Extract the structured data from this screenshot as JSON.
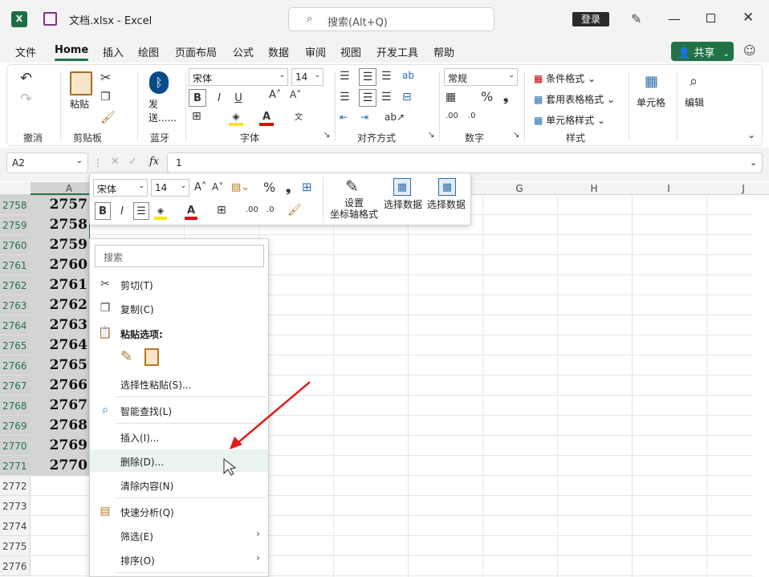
{
  "app": {
    "title": "文档.xlsx  -  Excel",
    "search_placeholder": "搜索(Alt+Q)",
    "login": "登录",
    "share": "共享",
    "accent": "#217346"
  },
  "tabs": [
    "文件",
    "Home",
    "插入",
    "绘图",
    "页面布局",
    "公式",
    "数据",
    "审阅",
    "视图",
    "开发工具",
    "帮助"
  ],
  "ribbon": {
    "groups": {
      "undo": "撤消",
      "clipboard": "剪贴板",
      "bluetooth": "蓝牙",
      "font": "字体",
      "align": "对齐方式",
      "number": "数字",
      "styles": "样式"
    },
    "paste": "粘贴",
    "send": "发送......",
    "font_name": "宋体",
    "font_size": "14",
    "number_format": "常规",
    "cond_format": "条件格式",
    "table_format": "套用表格格式",
    "cell_style": "单元格样式",
    "cells": "单元格",
    "editing": "编辑"
  },
  "formula": {
    "namebox": "A2",
    "fx": "fx",
    "value": "1"
  },
  "columns": [
    "A",
    "G",
    "H",
    "I",
    "J"
  ],
  "rows": [
    {
      "num": "2758",
      "val": "2757",
      "sel": true
    },
    {
      "num": "2759",
      "val": "2758",
      "sel": true
    },
    {
      "num": "2760",
      "val": "2759",
      "sel": true
    },
    {
      "num": "2761",
      "val": "2760",
      "sel": true
    },
    {
      "num": "2762",
      "val": "2761",
      "sel": true
    },
    {
      "num": "2763",
      "val": "2762",
      "sel": true
    },
    {
      "num": "2764",
      "val": "2763",
      "sel": true
    },
    {
      "num": "2765",
      "val": "2764",
      "sel": true
    },
    {
      "num": "2766",
      "val": "2765",
      "sel": true
    },
    {
      "num": "2767",
      "val": "2766",
      "sel": true
    },
    {
      "num": "2768",
      "val": "2767",
      "sel": true
    },
    {
      "num": "2769",
      "val": "2768",
      "sel": true
    },
    {
      "num": "2770",
      "val": "2769",
      "sel": true
    },
    {
      "num": "2771",
      "val": "2770",
      "sel": true
    },
    {
      "num": "2772",
      "val": "",
      "sel": false
    },
    {
      "num": "2773",
      "val": "",
      "sel": false
    },
    {
      "num": "2774",
      "val": "",
      "sel": false
    },
    {
      "num": "2775",
      "val": "",
      "sel": false
    },
    {
      "num": "2776",
      "val": "",
      "sel": false
    }
  ],
  "mini_toolbar": {
    "font_name": "宋体",
    "font_size": "14",
    "axis_format": "设置\n坐标轴格式",
    "select_data_1": "选择数据",
    "select_data_2": "选择数据"
  },
  "context_menu": {
    "search_placeholder": "搜索",
    "cut": "剪切(T)",
    "copy": "复制(C)",
    "paste_options": "粘贴选项:",
    "paste_special": "选择性粘贴(S)...",
    "smart_lookup": "智能查找(L)",
    "insert": "插入(I)...",
    "delete": "删除(D)...",
    "clear": "清除内容(N)",
    "quick_analysis": "快速分析(Q)",
    "filter": "筛选(E)",
    "sort": "排序(O)"
  }
}
